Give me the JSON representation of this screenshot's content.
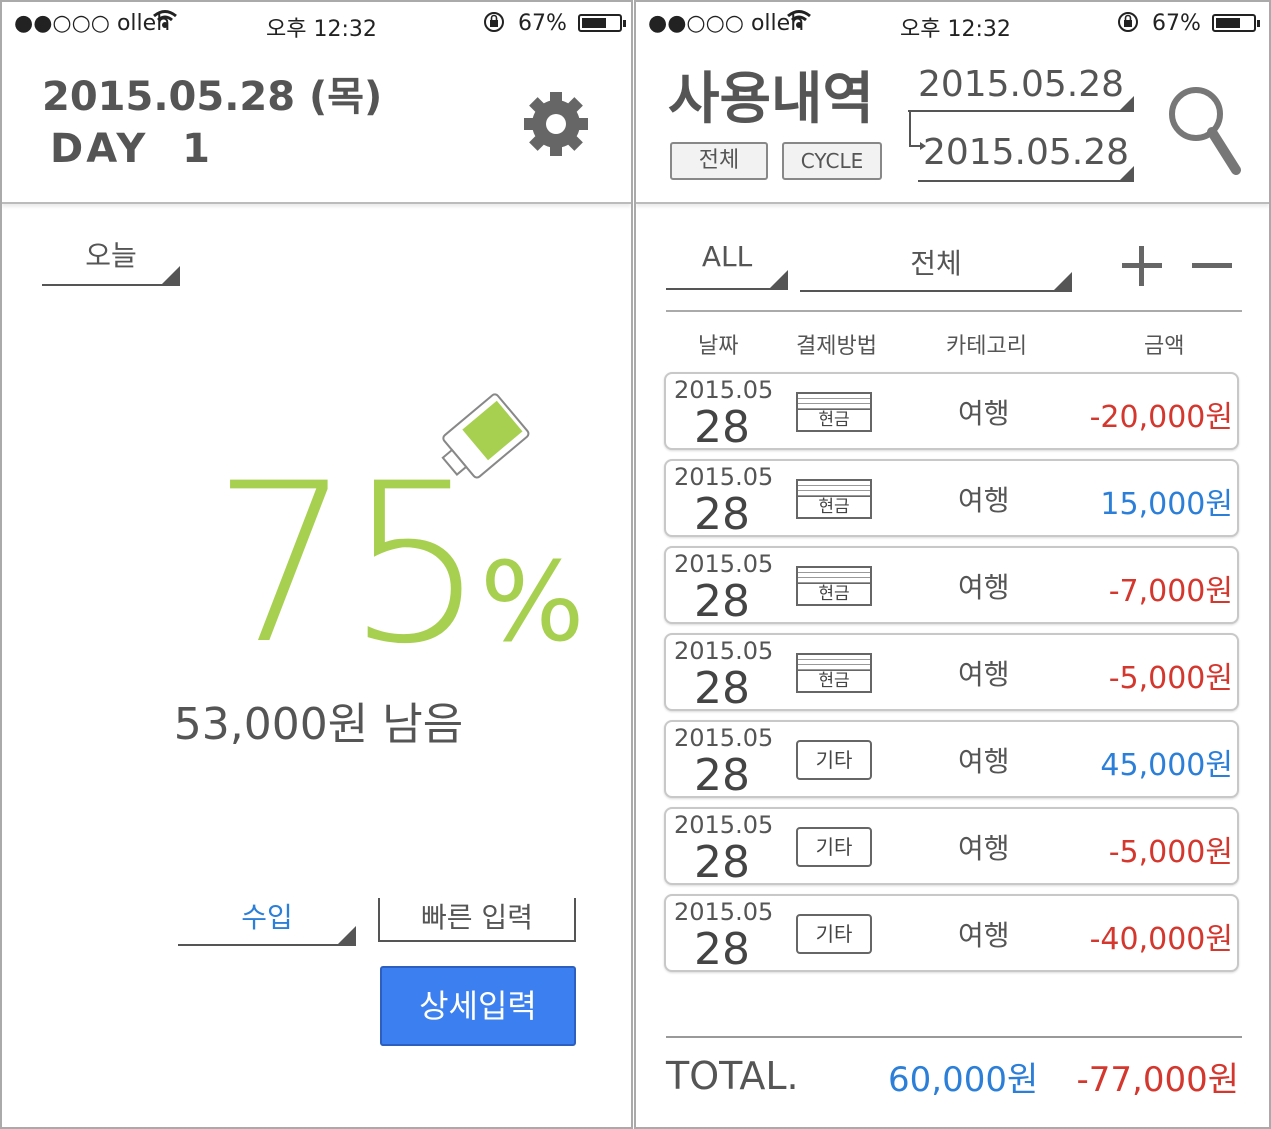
{
  "left": {
    "status": {
      "carrier": "●●○○○ olleh",
      "time": "오후 12:32",
      "battery": "67%",
      "battery_level": 0.67
    },
    "header": {
      "date": "2015.05.28 (목)",
      "day": "DAY  1"
    },
    "period_selector": "오늘",
    "percent": "75",
    "percent_sign": "%",
    "battery_icon_level": 0.75,
    "remaining": "53,000원 남음",
    "type_selector": "수입",
    "quick_input": "빠른 입력",
    "detail_button": "상세입력",
    "colors": {
      "accent_green": "#a8d050",
      "button_blue": "#3b7ff0"
    }
  },
  "right": {
    "status": {
      "carrier": "●●○○○ olleh",
      "time": "오후 12:32",
      "battery": "67%",
      "battery_level": 0.67
    },
    "title": "사용내역",
    "buttons": {
      "all": "전체",
      "cycle": "CYCLE"
    },
    "date_from": "2015.05.28",
    "date_to": "2015.05.28",
    "filters": {
      "pay_filter": "ALL",
      "category_filter": "전체"
    },
    "columns": [
      "날짜",
      "결제방법",
      "카테고리",
      "금액"
    ],
    "rows": [
      {
        "year_month": "2015.05",
        "day": "28",
        "pay": "현금",
        "pay_type": "cash",
        "category": "여행",
        "amount": "-20,000원",
        "sign": "neg"
      },
      {
        "year_month": "2015.05",
        "day": "28",
        "pay": "현금",
        "pay_type": "cash",
        "category": "여행",
        "amount": "15,000원",
        "sign": "pos"
      },
      {
        "year_month": "2015.05",
        "day": "28",
        "pay": "현금",
        "pay_type": "cash",
        "category": "여행",
        "amount": "-7,000원",
        "sign": "neg"
      },
      {
        "year_month": "2015.05",
        "day": "28",
        "pay": "현금",
        "pay_type": "cash",
        "category": "여행",
        "amount": "-5,000원",
        "sign": "neg"
      },
      {
        "year_month": "2015.05",
        "day": "28",
        "pay": "기타",
        "pay_type": "other",
        "category": "여행",
        "amount": "45,000원",
        "sign": "pos"
      },
      {
        "year_month": "2015.05",
        "day": "28",
        "pay": "기타",
        "pay_type": "other",
        "category": "여행",
        "amount": "-5,000원",
        "sign": "neg"
      },
      {
        "year_month": "2015.05",
        "day": "28",
        "pay": "기타",
        "pay_type": "other",
        "category": "여행",
        "amount": "-40,000원",
        "sign": "neg"
      }
    ],
    "total": {
      "label": "TOTAL.",
      "income": "60,000원",
      "expense": "-77,000원"
    }
  }
}
